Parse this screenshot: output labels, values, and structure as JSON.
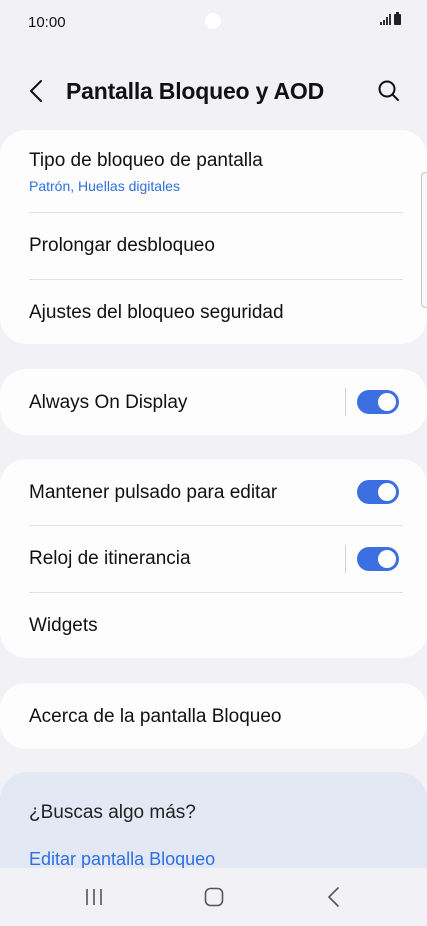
{
  "status_bar": {
    "time": "10:00"
  },
  "header": {
    "title": "Pantalla Bloqueo y AOD"
  },
  "sections": {
    "lock": {
      "lock_type_label": "Tipo de bloqueo de pantalla",
      "lock_type_value": "Patrón, Huellas digitales",
      "extend_unlock_label": "Prolongar desbloqueo",
      "secure_lock_label": "Ajustes del bloqueo seguridad"
    },
    "aod": {
      "label": "Always On Display",
      "enabled": true
    },
    "edit": {
      "hold_to_edit_label": "Mantener pulsado para editar",
      "hold_to_edit_enabled": true,
      "roaming_clock_label": "Reloj de itinerancia",
      "roaming_clock_enabled": true,
      "widgets_label": "Widgets"
    },
    "about": {
      "label": "Acerca de la pantalla Bloqueo"
    }
  },
  "suggestions": {
    "title": "¿Buscas algo más?",
    "link": "Editar pantalla Bloqueo"
  },
  "icons": {
    "back": "chevron-left-icon",
    "search": "search-icon",
    "recents": "recents-icon",
    "home": "home-icon",
    "nav_back": "nav-back-icon"
  },
  "colors": {
    "accent": "#3c6fe0",
    "link": "#2f6fe0",
    "background": "#f2f2f6",
    "card": "#fdfdfd",
    "suggest_card": "#e2e8f4"
  }
}
